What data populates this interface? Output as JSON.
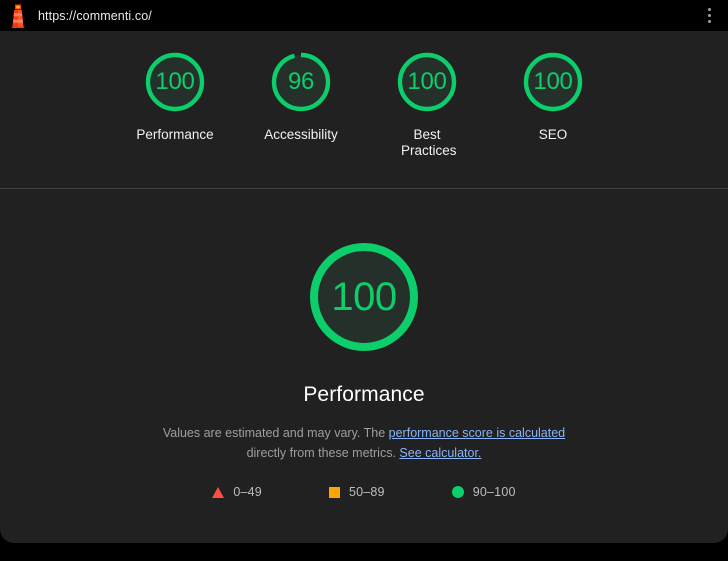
{
  "browser": {
    "url": "https://commenti.co/",
    "logo_icon": "lighthouse-icon",
    "menu_icon": "kebab-menu-icon"
  },
  "colors": {
    "pass": "#0CCE6B",
    "average": "#FFA400",
    "fail": "#FF4E42",
    "gauge_fill": "#26302B",
    "panel_bg": "#212121",
    "link": "#8AB4F8"
  },
  "scores": [
    {
      "label": "Performance",
      "value": "100",
      "numeric": 100,
      "rating": "pass"
    },
    {
      "label": "Accessibility",
      "value": "96",
      "numeric": 96,
      "rating": "pass"
    },
    {
      "label": "Best Practices",
      "value": "100",
      "numeric": 100,
      "rating": "pass"
    },
    {
      "label": "SEO",
      "value": "100",
      "numeric": 100,
      "rating": "pass"
    }
  ],
  "featured": {
    "value": "100",
    "numeric": 100,
    "title": "Performance",
    "disclaimer_prefix": "Values are estimated and may vary. The ",
    "link_1": "performance score is calculated",
    "disclaimer_middle": " directly from these metrics. ",
    "link_2": "See calculator."
  },
  "legend": [
    {
      "shape": "triangle",
      "range": "0–49",
      "color": "#FF4E42"
    },
    {
      "shape": "square",
      "range": "50–89",
      "color": "#FFA400"
    },
    {
      "shape": "circle",
      "range": "90–100",
      "color": "#0CCE6B"
    }
  ]
}
